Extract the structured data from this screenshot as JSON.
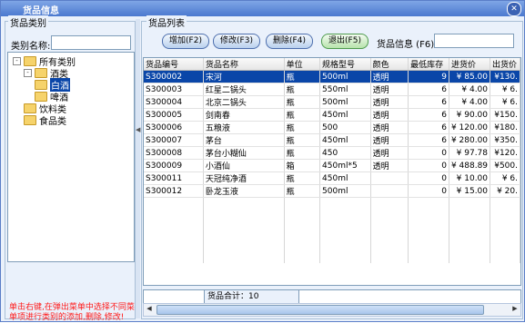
{
  "window": {
    "title": "货品信息",
    "close_icon": "close-icon"
  },
  "category_panel": {
    "group_title": "货品类别",
    "name_label": "类别名称:",
    "name_value": "",
    "tree": [
      {
        "label": "所有类别",
        "level": 0,
        "expander": "-"
      },
      {
        "label": "酒类",
        "level": 1,
        "expander": "-"
      },
      {
        "label": "白酒",
        "level": 2,
        "selected": true
      },
      {
        "label": "啤酒",
        "level": 2
      },
      {
        "label": "饮料类",
        "level": 1
      },
      {
        "label": "食品类",
        "level": 1
      }
    ],
    "tip": "单击右键,在弹出菜单中选择不同菜单项进行类别的添加,删除,修改!"
  },
  "goods_panel": {
    "group_title": "货品列表",
    "buttons": {
      "add": "增加(F2)",
      "edit": "修改(F3)",
      "delete": "删除(F4)",
      "exit": "退出(F5)"
    },
    "search_label": "货品信息 (F6):",
    "search_value": "",
    "columns": [
      "货品编号",
      "货品名称",
      "单位",
      "规格型号",
      "颜色",
      "最低库存",
      "进货价",
      "出货价"
    ],
    "rows": [
      {
        "cells": [
          "S300002",
          "宋河",
          "瓶",
          "500ml",
          "透明",
          "9",
          "¥ 85.00",
          "¥130."
        ],
        "selected": true
      },
      {
        "cells": [
          "S300003",
          "红星二锅头",
          "瓶",
          "550ml",
          "透明",
          "6",
          "¥ 4.00",
          "¥ 6."
        ]
      },
      {
        "cells": [
          "S300004",
          "北京二锅头",
          "瓶",
          "500ml",
          "透明",
          "6",
          "¥ 4.00",
          "¥ 6."
        ]
      },
      {
        "cells": [
          "S300005",
          "剑南春",
          "瓶",
          "450ml",
          "透明",
          "6",
          "¥ 90.00",
          "¥150."
        ]
      },
      {
        "cells": [
          "S300006",
          "五粮液",
          "瓶",
          "500",
          "透明",
          "6",
          "¥ 120.00",
          "¥180."
        ]
      },
      {
        "cells": [
          "S300007",
          "茅台",
          "瓶",
          "450ml",
          "透明",
          "6",
          "¥ 280.00",
          "¥350."
        ]
      },
      {
        "cells": [
          "S300008",
          "茅台小糊仙",
          "瓶",
          "450",
          "透明",
          "0",
          "¥ 97.78",
          "¥120."
        ]
      },
      {
        "cells": [
          "S300009",
          "小酒仙",
          "箱",
          "450ml*5",
          "透明",
          "0",
          "¥ 488.89",
          "¥500."
        ]
      },
      {
        "cells": [
          "S300011",
          "天冠纯净酒",
          "瓶",
          "450ml",
          "",
          "0",
          "¥ 10.00",
          "¥ 6."
        ]
      },
      {
        "cells": [
          "S300012",
          "卧龙玉液",
          "瓶",
          "500ml",
          "",
          "0",
          "¥ 15.00",
          "¥ 20."
        ]
      }
    ],
    "footer": "货品合计：10"
  }
}
